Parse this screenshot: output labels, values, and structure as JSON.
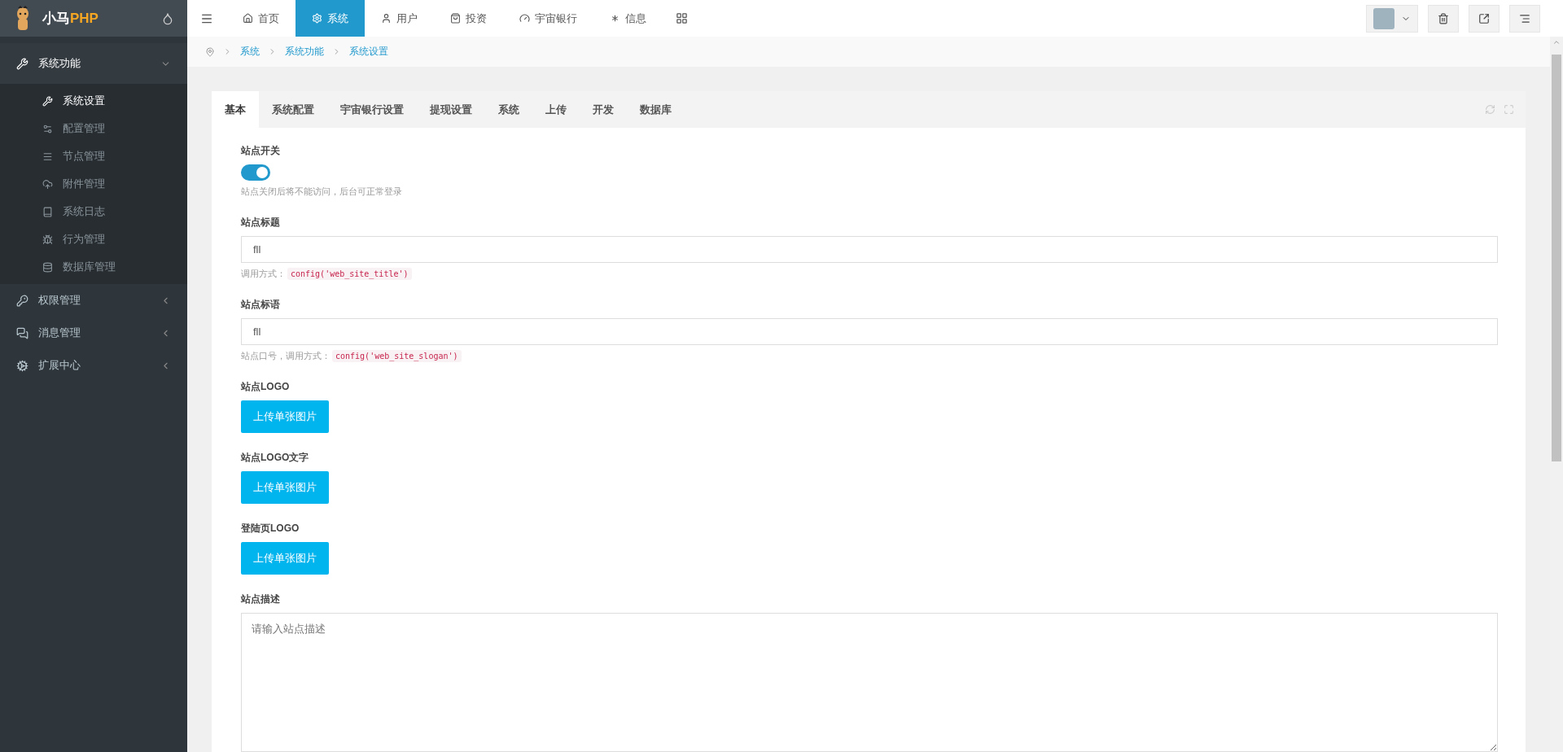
{
  "sidebar": {
    "logo": {
      "prefix": "小马",
      "suffix": "PHP"
    },
    "menu": [
      {
        "label": "系统功能",
        "expanded": true,
        "children": [
          {
            "label": "系统设置",
            "selected": true
          },
          {
            "label": "配置管理",
            "selected": false
          },
          {
            "label": "节点管理",
            "selected": false
          },
          {
            "label": "附件管理",
            "selected": false
          },
          {
            "label": "系统日志",
            "selected": false
          },
          {
            "label": "行为管理",
            "selected": false
          },
          {
            "label": "数据库管理",
            "selected": false
          }
        ]
      },
      {
        "label": "权限管理",
        "expanded": false
      },
      {
        "label": "消息管理",
        "expanded": false
      },
      {
        "label": "扩展中心",
        "expanded": false
      }
    ]
  },
  "topnav": [
    {
      "label": "首页",
      "selected": false
    },
    {
      "label": "系统",
      "selected": true
    },
    {
      "label": "用户",
      "selected": false
    },
    {
      "label": "投资",
      "selected": false
    },
    {
      "label": "宇宙银行",
      "selected": false
    },
    {
      "label": "信息",
      "selected": false
    }
  ],
  "breadcrumb": [
    "系统",
    "系统功能",
    "系统设置"
  ],
  "tabs": [
    {
      "label": "基本",
      "selected": true
    },
    {
      "label": "系统配置",
      "selected": false
    },
    {
      "label": "宇宙银行设置",
      "selected": false
    },
    {
      "label": "提现设置",
      "selected": false
    },
    {
      "label": "系统",
      "selected": false
    },
    {
      "label": "上传",
      "selected": false
    },
    {
      "label": "开发",
      "selected": false
    },
    {
      "label": "数据库",
      "selected": false
    }
  ],
  "fields": [
    {
      "kind": "switch",
      "label": "站点开关",
      "on": true,
      "help": {
        "text": "站点关闭后将不能访问，后台可正常登录"
      }
    },
    {
      "kind": "text",
      "label": "站点标题",
      "value": "fll",
      "help": {
        "text": "调用方式：",
        "code": "config('web_site_title')"
      }
    },
    {
      "kind": "text",
      "label": "站点标语",
      "value": "fll",
      "help": {
        "text": "站点口号，调用方式：",
        "code": "config('web_site_slogan')"
      }
    },
    {
      "kind": "upload",
      "label": "站点LOGO",
      "button": "上传单张图片"
    },
    {
      "kind": "upload",
      "label": "站点LOGO文字",
      "button": "上传单张图片"
    },
    {
      "kind": "upload",
      "label": "登陆页LOGO",
      "button": "上传单张图片"
    },
    {
      "kind": "textarea",
      "label": "站点描述",
      "placeholder": "请输入站点描述"
    }
  ]
}
